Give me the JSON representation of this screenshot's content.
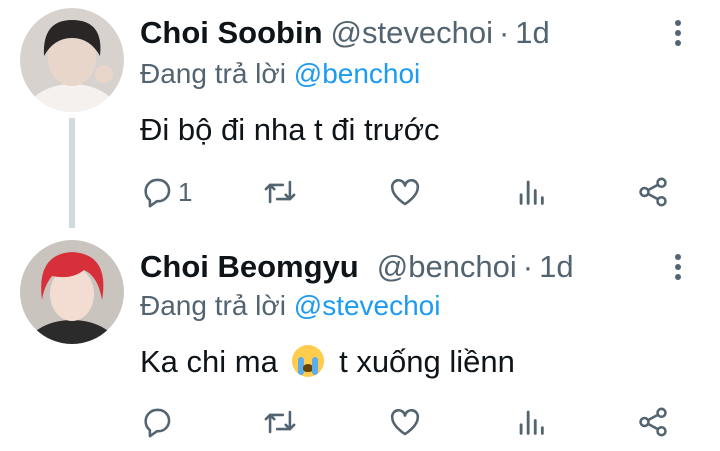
{
  "tweets": [
    {
      "name": "Choi Soobin",
      "handle": "@stevechoi",
      "separator": "·",
      "time": "1d",
      "reply_prefix": "Đang trả lời",
      "reply_mention": "@benchoi",
      "text": "Đi bộ đi nha t đi trước",
      "reply_count": "1",
      "avatar_colors": {
        "hair": "#2a2626",
        "skin": "#e9d6cb",
        "bg": "#d8d2cf"
      }
    },
    {
      "name": "Choi Beomgyu",
      "handle": "@benchoi",
      "separator": "·",
      "time": "1d",
      "reply_prefix": "Đang trả lời",
      "reply_mention": "@stevechoi",
      "text_before": "Ka chi ma",
      "emoji": "loudly-crying-face",
      "text_after": "t xuống liềnn",
      "reply_count": "",
      "avatar_colors": {
        "hair": "#d8303a",
        "skin": "#f3ddd3",
        "bg": "#c9c4be"
      }
    }
  ],
  "colors": {
    "text": "#0f1419",
    "muted": "#536471",
    "link": "#1d9bf0",
    "thread": "#cfd9de"
  },
  "action_icons": [
    "reply-icon",
    "retweet-icon",
    "like-icon",
    "views-icon",
    "share-icon"
  ]
}
